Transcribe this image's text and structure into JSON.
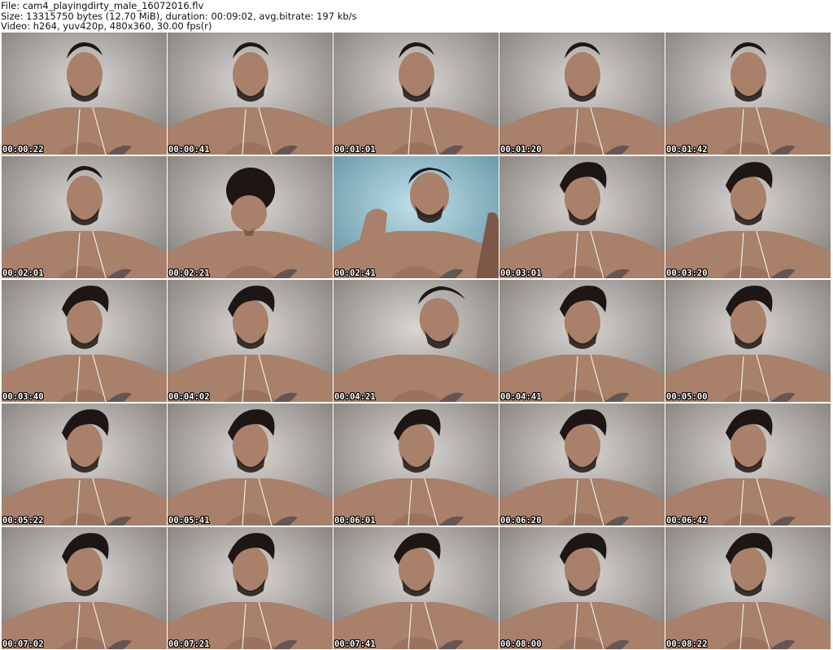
{
  "header": {
    "file_line": "File: cam4_playingdirty_male_16072016.flv",
    "size_line": "Size: 13315750 bytes (12.70 MiB), duration: 00:09:02, avg.bitrate: 197 kb/s",
    "video_line": "Video: h264, yuv420p, 480x360, 30.00 fps(r)"
  },
  "thumbnails": [
    {
      "timestamp": "00:00:22",
      "variant": "hair-back"
    },
    {
      "timestamp": "00:00:41",
      "variant": "hair-back"
    },
    {
      "timestamp": "00:01:01",
      "variant": "hair-back"
    },
    {
      "timestamp": "00:01:20",
      "variant": "hair-back"
    },
    {
      "timestamp": "00:01:42",
      "variant": "hair-back"
    },
    {
      "timestamp": "00:02:01",
      "variant": "hair-back"
    },
    {
      "timestamp": "00:02:21",
      "variant": "head-down"
    },
    {
      "timestamp": "00:02:41",
      "variant": "blue-arm-up"
    },
    {
      "timestamp": "00:03:01",
      "variant": "hair-side"
    },
    {
      "timestamp": "00:03:20",
      "variant": "hair-side"
    },
    {
      "timestamp": "00:03:40",
      "variant": "hair-side"
    },
    {
      "timestamp": "00:04:02",
      "variant": "hair-side"
    },
    {
      "timestamp": "00:04:21",
      "variant": "lean"
    },
    {
      "timestamp": "00:04:41",
      "variant": "hair-side"
    },
    {
      "timestamp": "00:05:00",
      "variant": "hair-side"
    },
    {
      "timestamp": "00:05:22",
      "variant": "hair-side"
    },
    {
      "timestamp": "00:05:41",
      "variant": "hair-side"
    },
    {
      "timestamp": "00:06:01",
      "variant": "hair-side"
    },
    {
      "timestamp": "00:06:20",
      "variant": "hair-side"
    },
    {
      "timestamp": "00:06:42",
      "variant": "hair-side"
    },
    {
      "timestamp": "00:07:02",
      "variant": "hair-side"
    },
    {
      "timestamp": "00:07:21",
      "variant": "hair-side"
    },
    {
      "timestamp": "00:07:41",
      "variant": "hair-side"
    },
    {
      "timestamp": "00:08:00",
      "variant": "hair-side"
    },
    {
      "timestamp": "00:08:22",
      "variant": "hair-side"
    }
  ]
}
